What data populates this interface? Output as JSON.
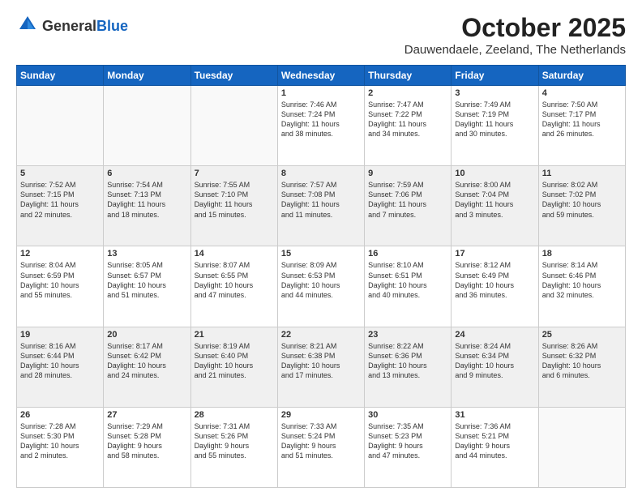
{
  "header": {
    "logo_general": "General",
    "logo_blue": "Blue",
    "month": "October 2025",
    "location": "Dauwendaele, Zeeland, The Netherlands"
  },
  "days_of_week": [
    "Sunday",
    "Monday",
    "Tuesday",
    "Wednesday",
    "Thursday",
    "Friday",
    "Saturday"
  ],
  "weeks": [
    [
      {
        "day": "",
        "info": ""
      },
      {
        "day": "",
        "info": ""
      },
      {
        "day": "",
        "info": ""
      },
      {
        "day": "1",
        "info": "Sunrise: 7:46 AM\nSunset: 7:24 PM\nDaylight: 11 hours\nand 38 minutes."
      },
      {
        "day": "2",
        "info": "Sunrise: 7:47 AM\nSunset: 7:22 PM\nDaylight: 11 hours\nand 34 minutes."
      },
      {
        "day": "3",
        "info": "Sunrise: 7:49 AM\nSunset: 7:19 PM\nDaylight: 11 hours\nand 30 minutes."
      },
      {
        "day": "4",
        "info": "Sunrise: 7:50 AM\nSunset: 7:17 PM\nDaylight: 11 hours\nand 26 minutes."
      }
    ],
    [
      {
        "day": "5",
        "info": "Sunrise: 7:52 AM\nSunset: 7:15 PM\nDaylight: 11 hours\nand 22 minutes."
      },
      {
        "day": "6",
        "info": "Sunrise: 7:54 AM\nSunset: 7:13 PM\nDaylight: 11 hours\nand 18 minutes."
      },
      {
        "day": "7",
        "info": "Sunrise: 7:55 AM\nSunset: 7:10 PM\nDaylight: 11 hours\nand 15 minutes."
      },
      {
        "day": "8",
        "info": "Sunrise: 7:57 AM\nSunset: 7:08 PM\nDaylight: 11 hours\nand 11 minutes."
      },
      {
        "day": "9",
        "info": "Sunrise: 7:59 AM\nSunset: 7:06 PM\nDaylight: 11 hours\nand 7 minutes."
      },
      {
        "day": "10",
        "info": "Sunrise: 8:00 AM\nSunset: 7:04 PM\nDaylight: 11 hours\nand 3 minutes."
      },
      {
        "day": "11",
        "info": "Sunrise: 8:02 AM\nSunset: 7:02 PM\nDaylight: 10 hours\nand 59 minutes."
      }
    ],
    [
      {
        "day": "12",
        "info": "Sunrise: 8:04 AM\nSunset: 6:59 PM\nDaylight: 10 hours\nand 55 minutes."
      },
      {
        "day": "13",
        "info": "Sunrise: 8:05 AM\nSunset: 6:57 PM\nDaylight: 10 hours\nand 51 minutes."
      },
      {
        "day": "14",
        "info": "Sunrise: 8:07 AM\nSunset: 6:55 PM\nDaylight: 10 hours\nand 47 minutes."
      },
      {
        "day": "15",
        "info": "Sunrise: 8:09 AM\nSunset: 6:53 PM\nDaylight: 10 hours\nand 44 minutes."
      },
      {
        "day": "16",
        "info": "Sunrise: 8:10 AM\nSunset: 6:51 PM\nDaylight: 10 hours\nand 40 minutes."
      },
      {
        "day": "17",
        "info": "Sunrise: 8:12 AM\nSunset: 6:49 PM\nDaylight: 10 hours\nand 36 minutes."
      },
      {
        "day": "18",
        "info": "Sunrise: 8:14 AM\nSunset: 6:46 PM\nDaylight: 10 hours\nand 32 minutes."
      }
    ],
    [
      {
        "day": "19",
        "info": "Sunrise: 8:16 AM\nSunset: 6:44 PM\nDaylight: 10 hours\nand 28 minutes."
      },
      {
        "day": "20",
        "info": "Sunrise: 8:17 AM\nSunset: 6:42 PM\nDaylight: 10 hours\nand 24 minutes."
      },
      {
        "day": "21",
        "info": "Sunrise: 8:19 AM\nSunset: 6:40 PM\nDaylight: 10 hours\nand 21 minutes."
      },
      {
        "day": "22",
        "info": "Sunrise: 8:21 AM\nSunset: 6:38 PM\nDaylight: 10 hours\nand 17 minutes."
      },
      {
        "day": "23",
        "info": "Sunrise: 8:22 AM\nSunset: 6:36 PM\nDaylight: 10 hours\nand 13 minutes."
      },
      {
        "day": "24",
        "info": "Sunrise: 8:24 AM\nSunset: 6:34 PM\nDaylight: 10 hours\nand 9 minutes."
      },
      {
        "day": "25",
        "info": "Sunrise: 8:26 AM\nSunset: 6:32 PM\nDaylight: 10 hours\nand 6 minutes."
      }
    ],
    [
      {
        "day": "26",
        "info": "Sunrise: 7:28 AM\nSunset: 5:30 PM\nDaylight: 10 hours\nand 2 minutes."
      },
      {
        "day": "27",
        "info": "Sunrise: 7:29 AM\nSunset: 5:28 PM\nDaylight: 9 hours\nand 58 minutes."
      },
      {
        "day": "28",
        "info": "Sunrise: 7:31 AM\nSunset: 5:26 PM\nDaylight: 9 hours\nand 55 minutes."
      },
      {
        "day": "29",
        "info": "Sunrise: 7:33 AM\nSunset: 5:24 PM\nDaylight: 9 hours\nand 51 minutes."
      },
      {
        "day": "30",
        "info": "Sunrise: 7:35 AM\nSunset: 5:23 PM\nDaylight: 9 hours\nand 47 minutes."
      },
      {
        "day": "31",
        "info": "Sunrise: 7:36 AM\nSunset: 5:21 PM\nDaylight: 9 hours\nand 44 minutes."
      },
      {
        "day": "",
        "info": ""
      }
    ]
  ]
}
